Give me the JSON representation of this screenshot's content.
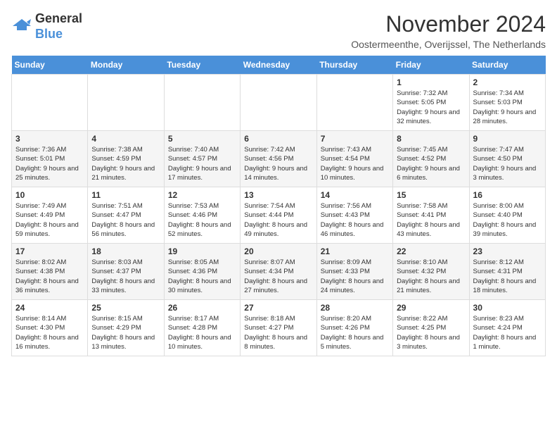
{
  "header": {
    "logo_line1": "General",
    "logo_line2": "Blue",
    "title": "November 2024",
    "subtitle": "Oostermeenthe, Overijssel, The Netherlands"
  },
  "days_of_week": [
    "Sunday",
    "Monday",
    "Tuesday",
    "Wednesday",
    "Thursday",
    "Friday",
    "Saturday"
  ],
  "weeks": [
    [
      {
        "day": "",
        "info": ""
      },
      {
        "day": "",
        "info": ""
      },
      {
        "day": "",
        "info": ""
      },
      {
        "day": "",
        "info": ""
      },
      {
        "day": "",
        "info": ""
      },
      {
        "day": "1",
        "info": "Sunrise: 7:32 AM\nSunset: 5:05 PM\nDaylight: 9 hours and 32 minutes."
      },
      {
        "day": "2",
        "info": "Sunrise: 7:34 AM\nSunset: 5:03 PM\nDaylight: 9 hours and 28 minutes."
      }
    ],
    [
      {
        "day": "3",
        "info": "Sunrise: 7:36 AM\nSunset: 5:01 PM\nDaylight: 9 hours and 25 minutes."
      },
      {
        "day": "4",
        "info": "Sunrise: 7:38 AM\nSunset: 4:59 PM\nDaylight: 9 hours and 21 minutes."
      },
      {
        "day": "5",
        "info": "Sunrise: 7:40 AM\nSunset: 4:57 PM\nDaylight: 9 hours and 17 minutes."
      },
      {
        "day": "6",
        "info": "Sunrise: 7:42 AM\nSunset: 4:56 PM\nDaylight: 9 hours and 14 minutes."
      },
      {
        "day": "7",
        "info": "Sunrise: 7:43 AM\nSunset: 4:54 PM\nDaylight: 9 hours and 10 minutes."
      },
      {
        "day": "8",
        "info": "Sunrise: 7:45 AM\nSunset: 4:52 PM\nDaylight: 9 hours and 6 minutes."
      },
      {
        "day": "9",
        "info": "Sunrise: 7:47 AM\nSunset: 4:50 PM\nDaylight: 9 hours and 3 minutes."
      }
    ],
    [
      {
        "day": "10",
        "info": "Sunrise: 7:49 AM\nSunset: 4:49 PM\nDaylight: 8 hours and 59 minutes."
      },
      {
        "day": "11",
        "info": "Sunrise: 7:51 AM\nSunset: 4:47 PM\nDaylight: 8 hours and 56 minutes."
      },
      {
        "day": "12",
        "info": "Sunrise: 7:53 AM\nSunset: 4:46 PM\nDaylight: 8 hours and 52 minutes."
      },
      {
        "day": "13",
        "info": "Sunrise: 7:54 AM\nSunset: 4:44 PM\nDaylight: 8 hours and 49 minutes."
      },
      {
        "day": "14",
        "info": "Sunrise: 7:56 AM\nSunset: 4:43 PM\nDaylight: 8 hours and 46 minutes."
      },
      {
        "day": "15",
        "info": "Sunrise: 7:58 AM\nSunset: 4:41 PM\nDaylight: 8 hours and 43 minutes."
      },
      {
        "day": "16",
        "info": "Sunrise: 8:00 AM\nSunset: 4:40 PM\nDaylight: 8 hours and 39 minutes."
      }
    ],
    [
      {
        "day": "17",
        "info": "Sunrise: 8:02 AM\nSunset: 4:38 PM\nDaylight: 8 hours and 36 minutes."
      },
      {
        "day": "18",
        "info": "Sunrise: 8:03 AM\nSunset: 4:37 PM\nDaylight: 8 hours and 33 minutes."
      },
      {
        "day": "19",
        "info": "Sunrise: 8:05 AM\nSunset: 4:36 PM\nDaylight: 8 hours and 30 minutes."
      },
      {
        "day": "20",
        "info": "Sunrise: 8:07 AM\nSunset: 4:34 PM\nDaylight: 8 hours and 27 minutes."
      },
      {
        "day": "21",
        "info": "Sunrise: 8:09 AM\nSunset: 4:33 PM\nDaylight: 8 hours and 24 minutes."
      },
      {
        "day": "22",
        "info": "Sunrise: 8:10 AM\nSunset: 4:32 PM\nDaylight: 8 hours and 21 minutes."
      },
      {
        "day": "23",
        "info": "Sunrise: 8:12 AM\nSunset: 4:31 PM\nDaylight: 8 hours and 18 minutes."
      }
    ],
    [
      {
        "day": "24",
        "info": "Sunrise: 8:14 AM\nSunset: 4:30 PM\nDaylight: 8 hours and 16 minutes."
      },
      {
        "day": "25",
        "info": "Sunrise: 8:15 AM\nSunset: 4:29 PM\nDaylight: 8 hours and 13 minutes."
      },
      {
        "day": "26",
        "info": "Sunrise: 8:17 AM\nSunset: 4:28 PM\nDaylight: 8 hours and 10 minutes."
      },
      {
        "day": "27",
        "info": "Sunrise: 8:18 AM\nSunset: 4:27 PM\nDaylight: 8 hours and 8 minutes."
      },
      {
        "day": "28",
        "info": "Sunrise: 8:20 AM\nSunset: 4:26 PM\nDaylight: 8 hours and 5 minutes."
      },
      {
        "day": "29",
        "info": "Sunrise: 8:22 AM\nSunset: 4:25 PM\nDaylight: 8 hours and 3 minutes."
      },
      {
        "day": "30",
        "info": "Sunrise: 8:23 AM\nSunset: 4:24 PM\nDaylight: 8 hours and 1 minute."
      }
    ]
  ]
}
